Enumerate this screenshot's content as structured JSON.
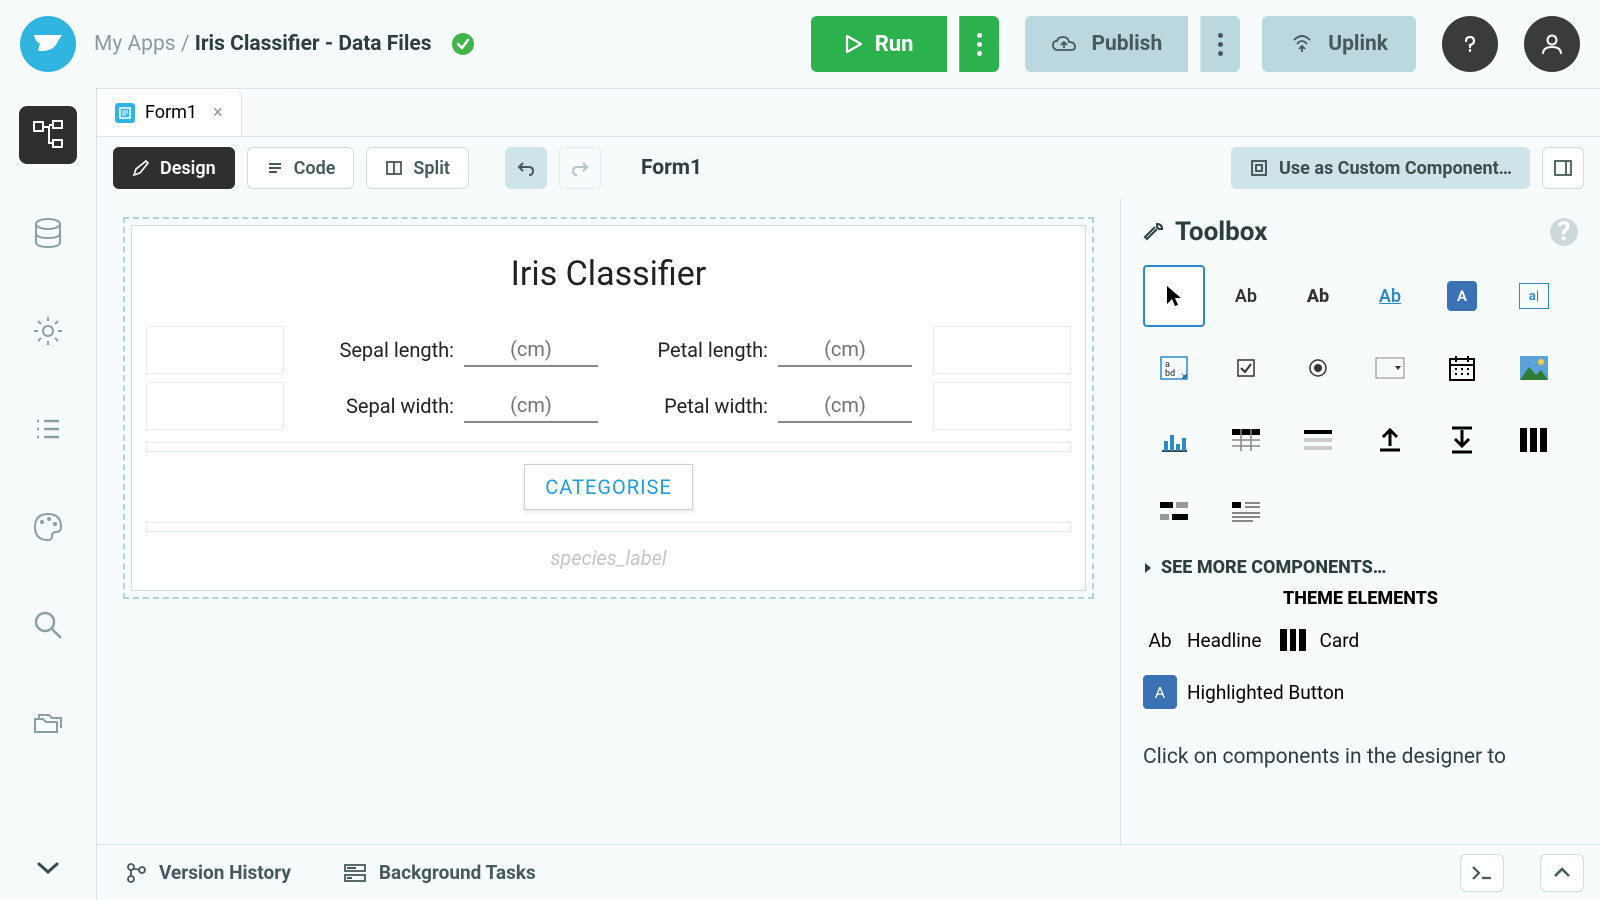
{
  "header": {
    "breadcrumb_root": "My Apps",
    "breadcrumb_sep": " / ",
    "breadcrumb_current": "Iris Classifier - Data Files",
    "run": "Run",
    "publish": "Publish",
    "uplink": "Uplink"
  },
  "tab": {
    "label": "Form1"
  },
  "toolbar": {
    "design": "Design",
    "code": "Code",
    "split": "Split",
    "form_name": "Form1",
    "custom": "Use as Custom Component…"
  },
  "form": {
    "title": "Iris Classifier",
    "sepal_length_label": "Sepal length:",
    "sepal_width_label": "Sepal width:",
    "petal_length_label": "Petal length:",
    "petal_width_label": "Petal width:",
    "placeholder": "(cm)",
    "button": "CATEGORISE",
    "species_placeholder": "species_label"
  },
  "toolbox": {
    "title": "Toolbox",
    "see_more": "SEE MORE COMPONENTS…",
    "theme_title": "THEME ELEMENTS",
    "headline": "Headline",
    "card": "Card",
    "highlighted_button": "Highlighted Button",
    "hint": "Click on components in the designer to"
  },
  "footer": {
    "version_history": "Version History",
    "background_tasks": "Background Tasks"
  }
}
